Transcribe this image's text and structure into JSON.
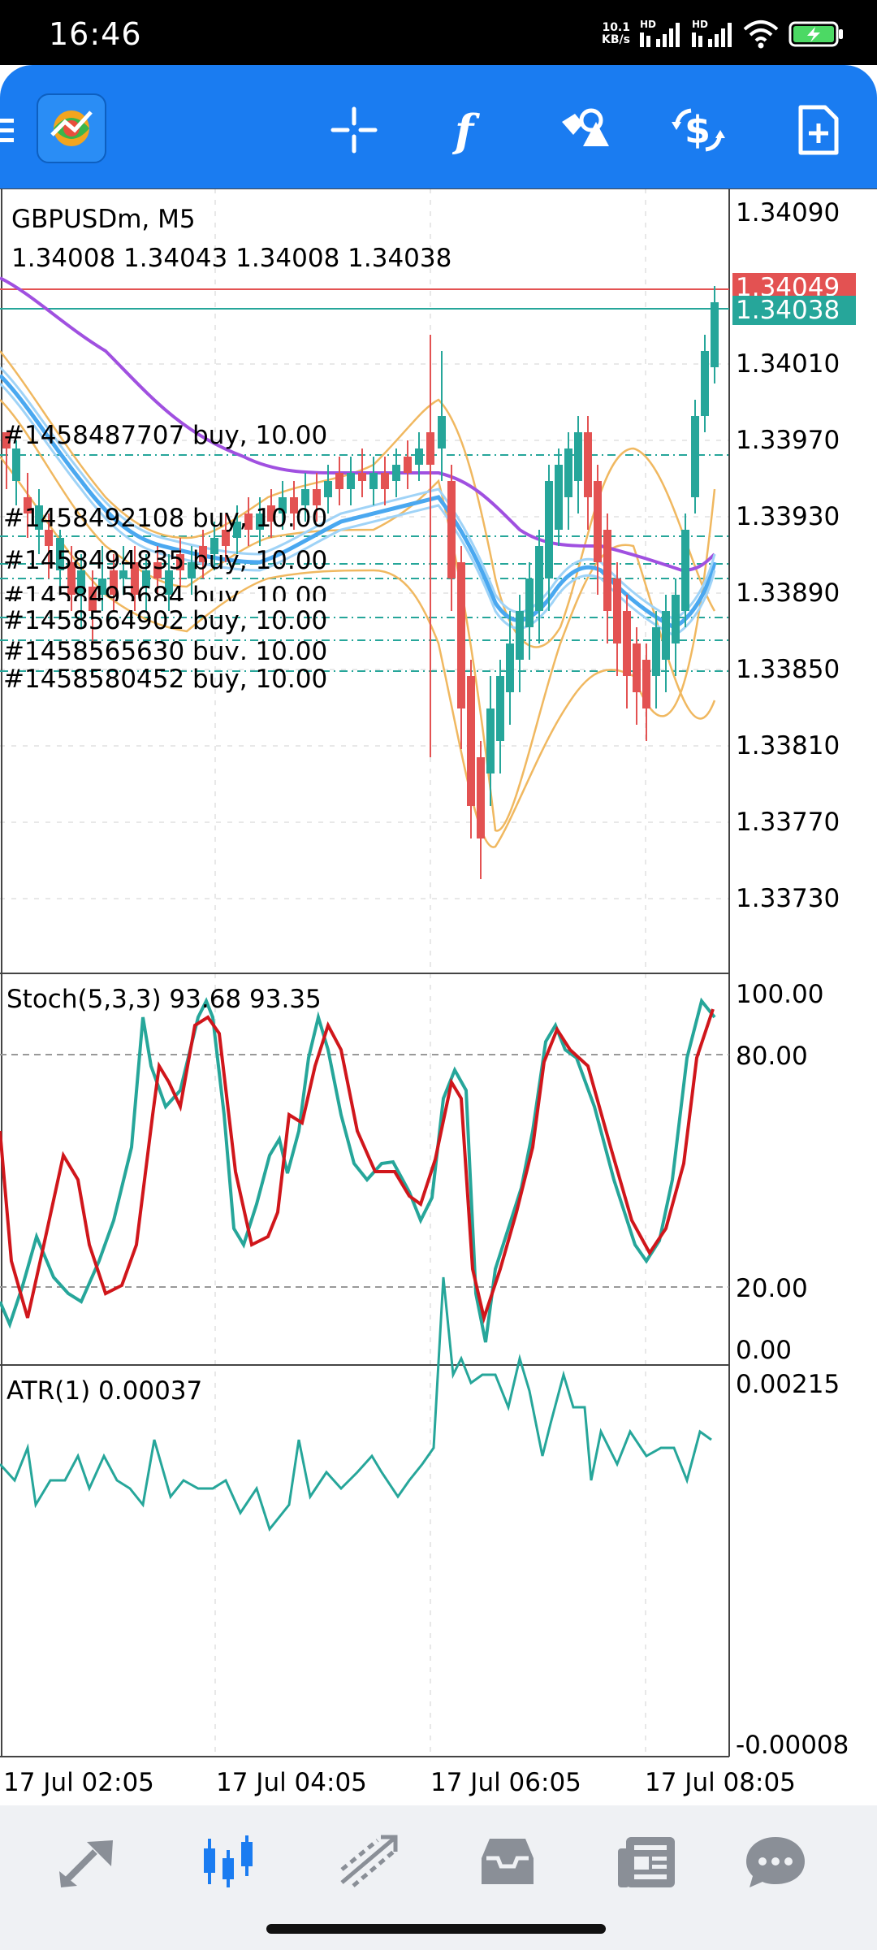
{
  "status_bar": {
    "time": "16:46",
    "net_speed_value": "10.1",
    "net_speed_unit": "KB/s",
    "signal1_label": "HD",
    "signal2_label": "HD"
  },
  "toolbar": {
    "menu_icon": "hamburger-menu-icon",
    "app_logo": "metatrader-logo",
    "crosshair_icon": "crosshair-icon",
    "indicators_icon": "function-f-icon",
    "objects_icon": "shapes-icon",
    "trade_icon": "dollar-refresh-icon",
    "new_order_icon": "add-document-icon",
    "accent_color": "#1a7cf1"
  },
  "main_chart": {
    "symbol_timeframe": "GBPUSDm, M5",
    "ohlc": "1.34008 1.34043 1.34008 1.34038",
    "price_axis": [
      "1.34090",
      "1.34010",
      "1.33970",
      "1.33930",
      "1.33890",
      "1.33850",
      "1.33810",
      "1.33770",
      "1.33730"
    ],
    "ask_label": "1.34049",
    "bid_label": "1.34038",
    "ask_color": "#e35252",
    "bid_color": "#26a69a",
    "orders": [
      "#1458487707 buy, 10.00",
      "#1458492108 buy, 10.00",
      "#1458494835 buy, 10.00",
      "#1458495684 buy, 10.00",
      "#1458564902 buy, 10.00",
      "#1458565630 buy, 10.00",
      "#1458580452 buy, 10.00"
    ]
  },
  "stoch_panel": {
    "label": "Stoch(5,3,3) 93.68 93.35",
    "axis": [
      "100.00",
      "80.00",
      "20.00",
      "0.00"
    ],
    "main_color": "#26a69a",
    "signal_color": "#d0161b"
  },
  "atr_panel": {
    "label": "ATR(1) 0.00037",
    "axis_top": "0.00215",
    "axis_bottom": "-0.00008",
    "line_color": "#26a69a"
  },
  "time_axis": [
    "17 Jul 02:05",
    "17 Jul 04:05",
    "17 Jul 06:05",
    "17 Jul 08:05"
  ],
  "bottom_nav": {
    "items": [
      "quotes-arrows-icon",
      "chart-candles-icon",
      "trade-lines-icon",
      "history-inbox-icon",
      "news-icon",
      "messages-chat-icon"
    ],
    "active_index": 1,
    "active_color": "#1a7cf1"
  }
}
